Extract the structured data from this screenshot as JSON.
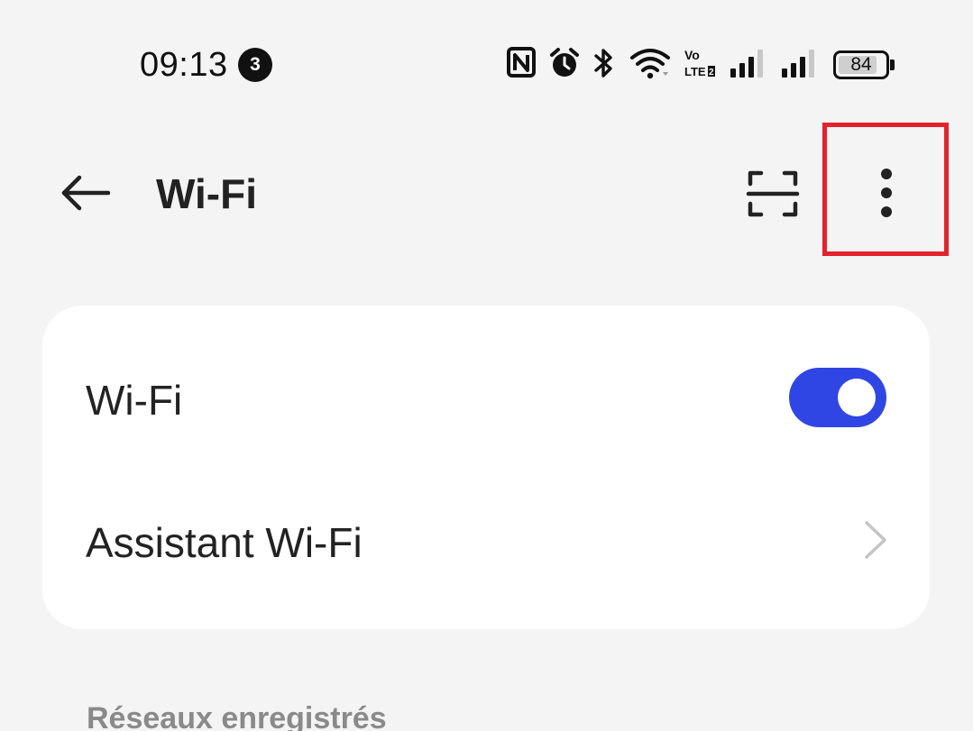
{
  "status_bar": {
    "time": "09:13",
    "notification_count": "3",
    "icons": [
      "nfc-icon",
      "alarm-icon",
      "bluetooth-icon",
      "wifi-signal-icon",
      "volte-icon",
      "cell-signal-icon",
      "cell-signal-icon"
    ],
    "battery": {
      "level_text": "84",
      "level_percent": 84
    }
  },
  "app_bar": {
    "title": "Wi-Fi",
    "back_icon": "arrow-left-icon",
    "scan_icon": "qr-scan-icon",
    "more_icon": "more-vertical-icon",
    "highlight_color": "#e3222b"
  },
  "settings": {
    "wifi_toggle": {
      "label": "Wi-Fi",
      "state": "on",
      "accent_color": "#3046e4"
    },
    "assistant": {
      "label": "Assistant Wi-Fi",
      "icon": "chevron-right-icon"
    }
  },
  "saved_networks": {
    "header": "Réseaux enregistrés"
  }
}
